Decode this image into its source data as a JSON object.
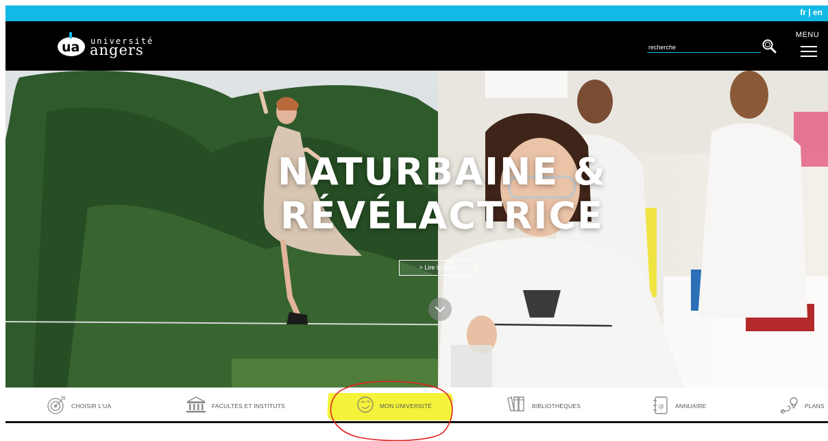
{
  "lang": {
    "fr": "fr",
    "separator": "|",
    "en": "en"
  },
  "header": {
    "logo_top": "université",
    "logo_main": "angers",
    "logo_mark": "ua",
    "search_placeholder": "recherche",
    "menu_label": "MENU"
  },
  "hero": {
    "title_line1": "NATURBAINE &",
    "title_line2": "RÉVÉLACTRICE",
    "read_more": "> Lire la suite"
  },
  "quick_nav": [
    {
      "label": "CHOISIR L'UA",
      "icon": "target-icon"
    },
    {
      "label": "FACULTÉS ET INSTITUTS",
      "icon": "building-icon"
    },
    {
      "label": "MON UNIVERSITÉ",
      "icon": "smile-icon"
    },
    {
      "label": "BIBLIOTHÈQUES",
      "icon": "books-icon"
    },
    {
      "label": "ANNUAIRE",
      "icon": "contact-book-icon"
    },
    {
      "label": "PLANS",
      "icon": "map-pin-icon"
    }
  ],
  "colors": {
    "accent": "#12b9e6",
    "header_bg": "#000000",
    "highlight": "#f5f23a",
    "annotation": "#e0201c"
  }
}
